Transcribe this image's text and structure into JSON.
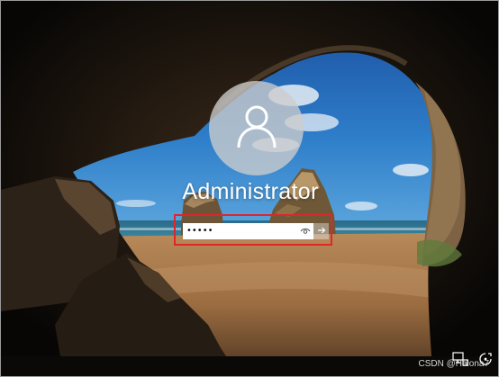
{
  "login": {
    "username": "Administrator",
    "password_masked": "•••••"
  },
  "icons": {
    "avatar": "user-avatar-icon",
    "reveal": "eye-icon",
    "submit": "arrow-right-icon",
    "network": "network-icon",
    "accessibility": "ease-of-access-icon"
  },
  "watermark": "CSDN @Halona7",
  "colors": {
    "highlight": "#e0252b",
    "text": "#ffffff"
  }
}
